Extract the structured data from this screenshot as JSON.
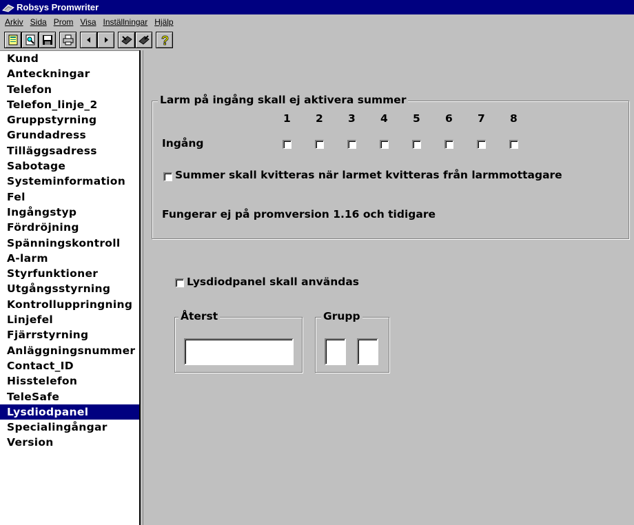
{
  "window": {
    "title": "Robsys Promwriter"
  },
  "menu": [
    {
      "label": "Arkiv"
    },
    {
      "label": "Sida"
    },
    {
      "label": "Prom"
    },
    {
      "label": "Visa"
    },
    {
      "label": "Inställningar"
    },
    {
      "label": "Hjälp"
    }
  ],
  "toolbar": {
    "icons": [
      "new-document-icon",
      "preview-icon",
      "save-icon",
      "print-icon",
      "previous-arrow-icon",
      "next-arrow-icon",
      "chip-read-icon",
      "chip-write-icon",
      "help-icon"
    ]
  },
  "sidebar": {
    "items": [
      "Kund",
      "Anteckningar",
      "Telefon",
      "Telefon_linje_2",
      "Gruppstyrning",
      "Grundadress",
      "Tilläggsadress",
      "Sabotage",
      "Systeminformation",
      "Fel",
      "Ingångstyp",
      "Fördröjning",
      "Spänningskontroll",
      "A-larm",
      "Styrfunktioner",
      "Utgångsstyrning",
      "Kontrolluppringning",
      "Linjefel",
      "Fjärrstyrning",
      "Anläggningsnummer",
      "Contact_ID",
      "Hisstelefon",
      "TeleSafe",
      "Lysdiodpanel",
      "Specialingångar",
      "Version"
    ],
    "selected": "Lysdiodpanel"
  },
  "alarm_group": {
    "title": "Larm på ingång skall ej aktivera summer",
    "input_label": "Ingång",
    "columns": [
      "1",
      "2",
      "3",
      "4",
      "5",
      "6",
      "7",
      "8"
    ],
    "summer_checkbox_label": "Summer skall kvitteras när larmet kvitteras från larmmottagare",
    "note": "Fungerar ej på promversion 1.16 och tidigare"
  },
  "panel": {
    "use_checkbox_label": "Lysdiodpanel skall användas",
    "aterst_title": "Återst",
    "grupp_title": "Grupp"
  },
  "colors": {
    "titlebar": "#000080",
    "selection": "#000080",
    "face": "#c0c0c0"
  }
}
